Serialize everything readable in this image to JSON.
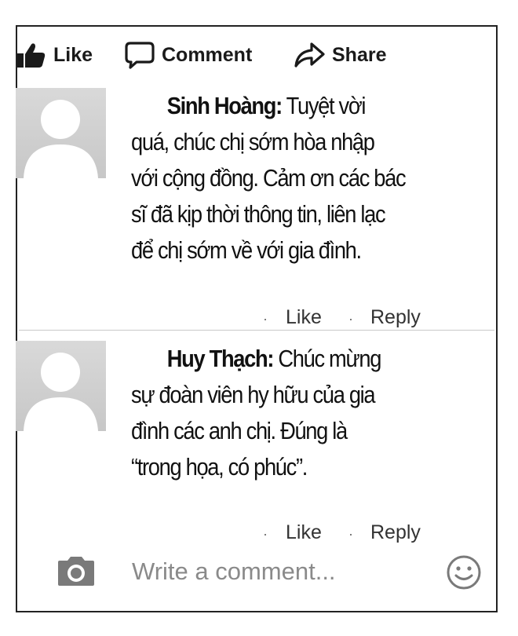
{
  "actions": {
    "like_label": "Like",
    "comment_label": "Comment",
    "share_label": "Share"
  },
  "comments": [
    {
      "author": "Sinh Hoàng:",
      "lines": [
        "Tuyệt vời",
        "quá, chúc chị sớm hòa nhập",
        "với cộng đồng. Cảm ơn các bác",
        "sĩ đã kịp thời thông tin, liên lạc",
        "để chị sớm về với gia đình."
      ],
      "like_label": "Like",
      "reply_label": "Reply",
      "separator": "·"
    },
    {
      "author": "Huy Thạch:",
      "lines": [
        "Chúc mừng",
        "sự đoàn viên hy hữu của gia",
        "đình các anh chị. Đúng là",
        "“trong họa, có phúc”."
      ],
      "like_label": "Like",
      "reply_label": "Reply",
      "separator": "·"
    }
  ],
  "composer": {
    "placeholder": "Write a comment..."
  },
  "icons": {
    "like": "thumbs-up-icon",
    "comment": "speech-bubble-icon",
    "share": "share-arrow-icon",
    "camera": "camera-icon",
    "emoji": "smiley-icon",
    "avatar": "default-avatar-icon"
  },
  "colors": {
    "text": "#111111",
    "muted": "#8a8a8a",
    "icon": "#7a7a7a",
    "avatar_bg": "#d0d0d0"
  }
}
